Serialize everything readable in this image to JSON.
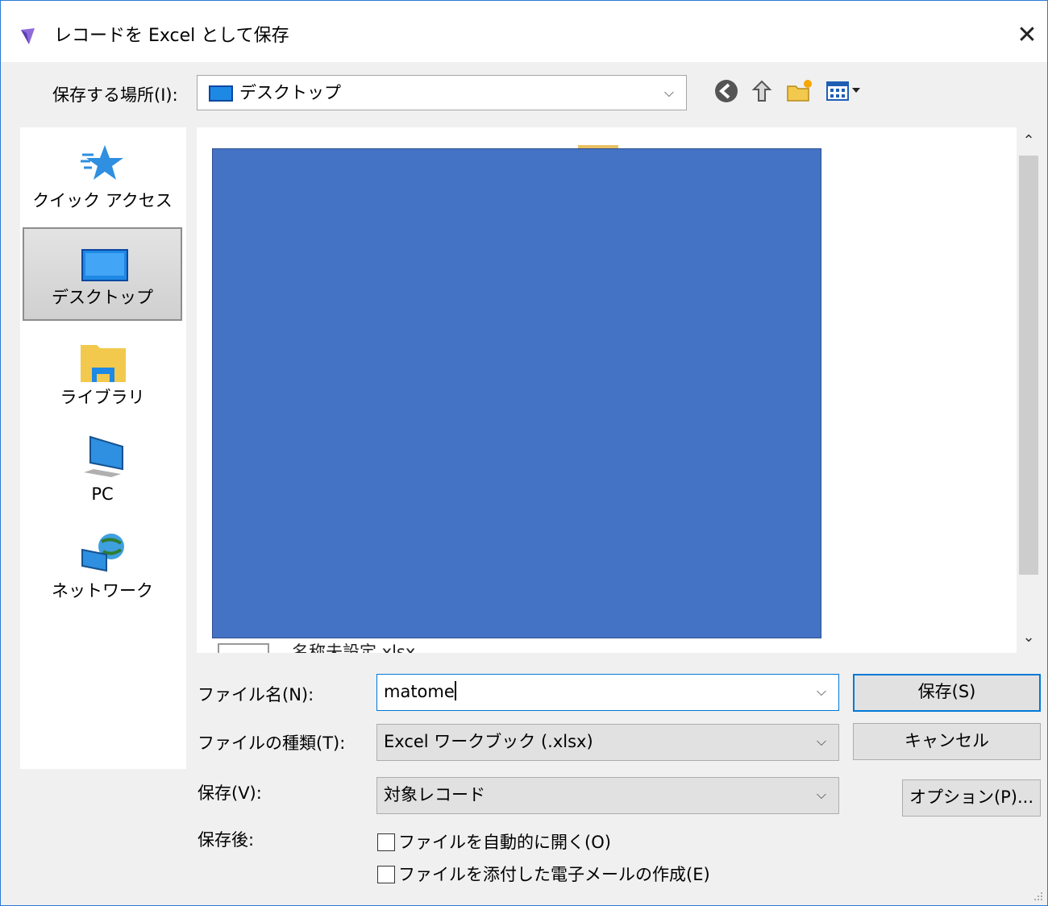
{
  "window": {
    "title": "レコードを Excel として保存",
    "close_glyph": "✕"
  },
  "location": {
    "label": "保存する場所(I):",
    "value": "デスクトップ"
  },
  "toolbar": {
    "icons": [
      "back-icon",
      "up-folder-icon",
      "new-folder-icon",
      "view-menu-icon"
    ]
  },
  "places": [
    {
      "label": "クイック アクセス",
      "icon": "star-icon"
    },
    {
      "label": "デスクトップ",
      "icon": "desktop-icon",
      "selected": true
    },
    {
      "label": "ライブラリ",
      "icon": "library-icon"
    },
    {
      "label": "PC",
      "icon": "pc-icon"
    },
    {
      "label": "ネットワーク",
      "icon": "network-icon"
    }
  ],
  "file_list": {
    "partial_file_name": "名称未設定.xlsx",
    "redacted_color": "#4472c4"
  },
  "form": {
    "filename": {
      "label": "ファイル名(N):",
      "value": "matome"
    },
    "filetype": {
      "label": "ファイルの種類(T):",
      "value": "Excel ワークブック (.xlsx)"
    },
    "save_scope": {
      "label": "保存(V):",
      "value": "対象レコード"
    },
    "after_save": {
      "label": "保存後:"
    }
  },
  "buttons": {
    "save": "保存(S)",
    "cancel": "キャンセル",
    "options": "オプション(P)..."
  },
  "checkboxes": [
    {
      "label": "ファイルを自動的に開く(O)",
      "checked": false
    },
    {
      "label": "ファイルを添付した電子メールの作成(E)",
      "checked": false
    }
  ],
  "colors": {
    "accent": "#0078d7",
    "window_border": "#2b79d6"
  }
}
